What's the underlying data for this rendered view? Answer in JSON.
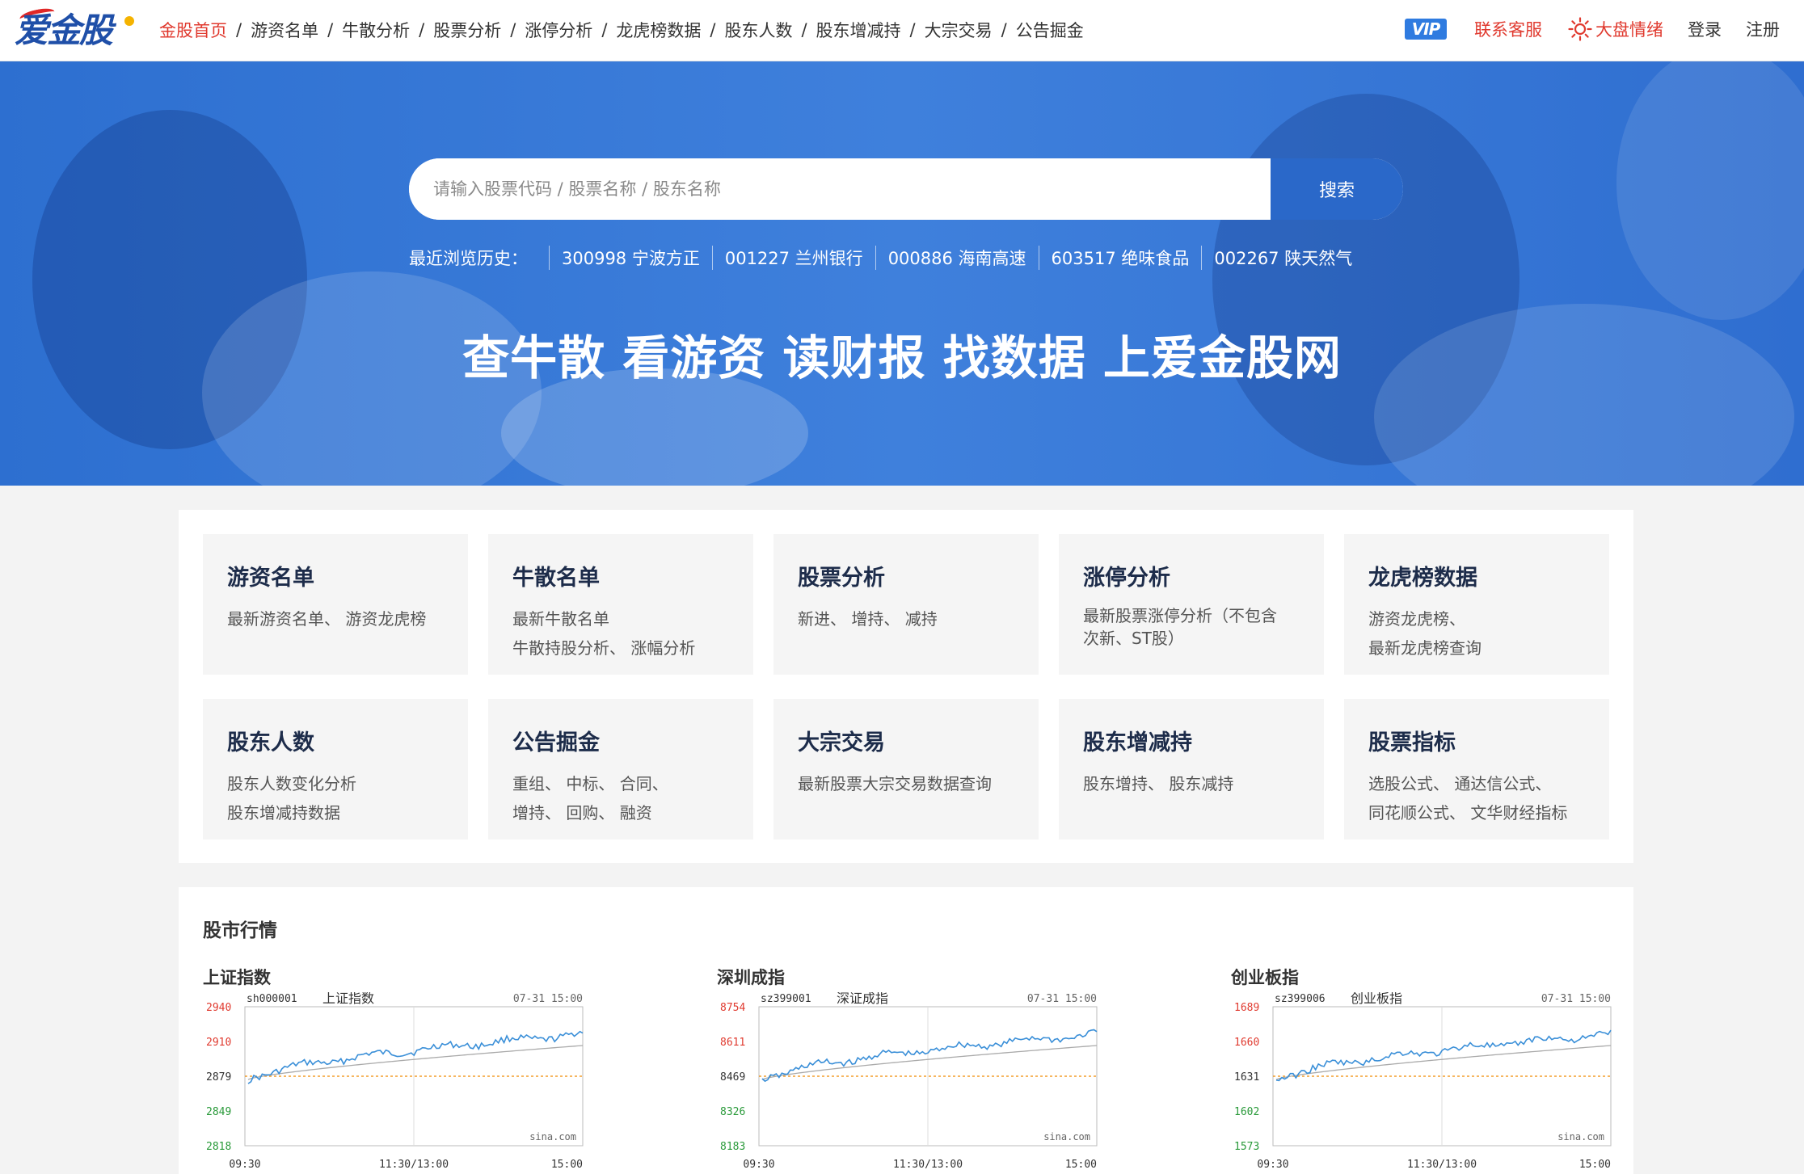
{
  "brand": {
    "logo_text": "爱金股"
  },
  "nav": {
    "items": [
      "金股首页",
      "游资名单",
      "牛散分析",
      "股票分析",
      "涨停分析",
      "龙虎榜数据",
      "股东人数",
      "股东增减持",
      "大宗交易",
      "公告掘金"
    ],
    "separator": "/",
    "active_index": 0
  },
  "nav_right": {
    "vip": "VIP",
    "contact": "联系客服",
    "market_mood": "大盘情绪",
    "login": "登录",
    "register": "注册"
  },
  "search": {
    "placeholder": "请输入股票代码 / 股票名称 / 股东名称",
    "button": "搜索"
  },
  "history": {
    "label": "最近浏览历史：",
    "items": [
      "300998 宁波方正",
      "001227 兰州银行",
      "000886 海南高速",
      "603517 绝味食品",
      "002267 陕天然气"
    ]
  },
  "slogan": "查牛散 看游资 读财报 找数据 上爱金股网",
  "categories": [
    {
      "title": "游资名单",
      "desc": "最新游资名单、 游资龙虎榜"
    },
    {
      "title": "牛散名单",
      "desc1": "最新牛散名单",
      "desc2": "牛散持股分析、 涨幅分析"
    },
    {
      "title": "股票分析",
      "desc": "新进、 增持、 减持"
    },
    {
      "title": "涨停分析",
      "desc1": "最新股票涨停分析（不包含",
      "desc2": "次新、ST股）"
    },
    {
      "title": "龙虎榜数据",
      "desc1": "游资龙虎榜、",
      "desc2": "最新龙虎榜查询"
    },
    {
      "title": "股东人数",
      "desc1": "股东人数变化分析",
      "desc2": "股东增减持数据"
    },
    {
      "title": "公告掘金",
      "desc1": "重组、 中标、 合同、",
      "desc2": "增持、 回购、 融资"
    },
    {
      "title": "大宗交易",
      "desc": "最新股票大宗交易数据查询"
    },
    {
      "title": "股东增减持",
      "desc": "股东增持、 股东减持"
    },
    {
      "title": "股票指标",
      "desc1": "选股公式、 通达信公式、",
      "desc2": "同花顺公式、 文华财经指标"
    }
  ],
  "market": {
    "title": "股市行情",
    "indices": [
      {
        "name": "上证指数",
        "code": "sh000001",
        "chart_name": "上证指数",
        "datetime": "07-31 15:00",
        "yticks": [
          "2940",
          "2910",
          "2879",
          "2849",
          "2818"
        ],
        "xticks": [
          "09:30",
          "11:30/13:00",
          "15:00"
        ],
        "source": "sina.com"
      },
      {
        "name": "深圳成指",
        "code": "sz399001",
        "chart_name": "深证成指",
        "datetime": "07-31 15:00",
        "yticks": [
          "8754",
          "8611",
          "8469",
          "8326",
          "8183"
        ],
        "xticks": [
          "09:30",
          "11:30/13:00",
          "15:00"
        ],
        "source": "sina.com"
      },
      {
        "name": "创业板指",
        "code": "sz399006",
        "chart_name": "创业板指",
        "datetime": "07-31 15:00",
        "yticks": [
          "1689",
          "1660",
          "1631",
          "1602",
          "1573"
        ],
        "xticks": [
          "09:30",
          "11:30/13:00",
          "15:00"
        ],
        "source": "sina.com"
      }
    ]
  },
  "colors": {
    "accent_red": "#e03a2f",
    "brand_blue": "#2a68c9",
    "up_red": "#e03a2f",
    "down_green": "#2a9a3a",
    "line_blue": "#3a8fd8"
  }
}
